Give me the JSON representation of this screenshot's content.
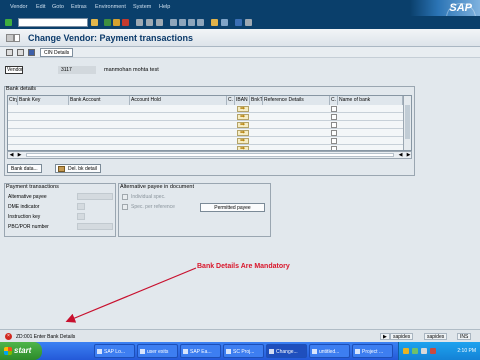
{
  "menu": {
    "items": [
      "Vendor",
      "Edit",
      "Goto",
      "Extras",
      "Environment",
      "System",
      "Help"
    ],
    "logo": "SAP"
  },
  "title": "Change Vendor: Payment transactions",
  "app_toolbar": {
    "cin_label": "CIN Details"
  },
  "vendor": {
    "label": "Vendor",
    "number": "3117",
    "name": "manmohan mohta test"
  },
  "bank_details": {
    "title": "Bank details",
    "columns": [
      "Ctry",
      "Bank Key",
      "Bank Account",
      "Account Hold",
      "C.",
      "IBAN",
      "BnkT",
      "Reference Details",
      "C.",
      "Name of bank"
    ],
    "row_count": 6,
    "buttons": {
      "bank_data": "Bank data...",
      "delete": "Del. bk detail"
    }
  },
  "payment_transactions": {
    "title": "Payment transactions",
    "fields": [
      "Alternative payee",
      "DME indicator",
      "Instruction key",
      "PBC/POR number"
    ]
  },
  "alternative_payee": {
    "title": "Alternative payee in document",
    "checkboxes": [
      "Individual spec.",
      "Spec. per reference"
    ],
    "button": "Permitted payee"
  },
  "annotation": "Bank Details Are Mandatory",
  "status": {
    "message": "ZD:001 Enter Bank Details",
    "system": "sapides",
    "server": "sapides",
    "mode": "INS"
  },
  "taskbar": {
    "start": "start",
    "windows": [
      "SAP Lo...",
      "user exits",
      "SAP Ea...",
      "SC Proj...",
      "Change...",
      "untitled...",
      "Project ..."
    ],
    "active_index": 4,
    "clock": "2:10 PM"
  }
}
